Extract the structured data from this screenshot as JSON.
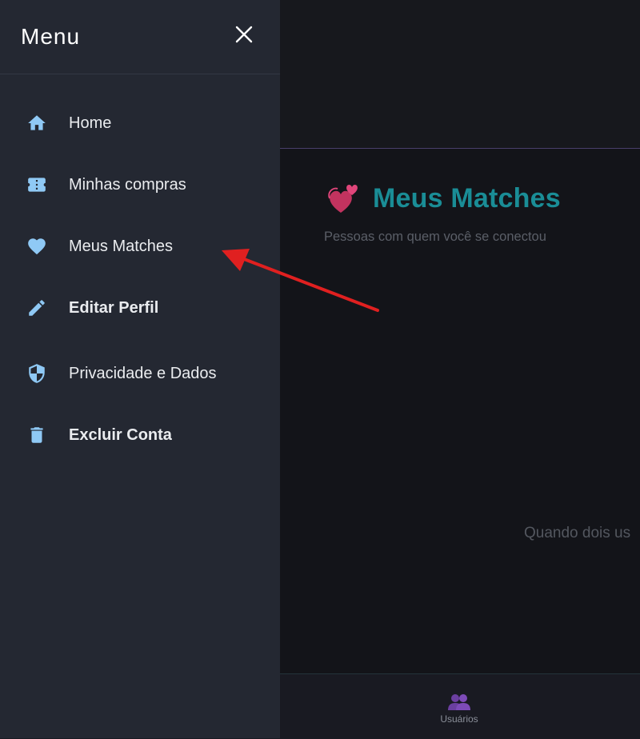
{
  "drawer": {
    "title": "Menu",
    "items": [
      {
        "label": "Home",
        "icon": "home-icon"
      },
      {
        "label": "Minhas compras",
        "icon": "ticket-icon"
      },
      {
        "label": "Meus Matches",
        "icon": "heart-icon"
      },
      {
        "label": "Editar Perfil",
        "icon": "pencil-icon"
      },
      {
        "label": "Privacidade e Dados",
        "icon": "shield-icon"
      },
      {
        "label": "Excluir Conta",
        "icon": "trash-icon"
      }
    ]
  },
  "main": {
    "title": "Meus Matches",
    "subtitle": "Pessoas com quem você se conectou",
    "empty_text": "Quando dois us"
  },
  "bottom_nav": {
    "users_label": "Usuários"
  },
  "colors": {
    "drawer_bg": "#242832",
    "accent_icon": "#8fc9f5",
    "title_teal": "#1a8d96",
    "arrow_red": "#e02020"
  }
}
